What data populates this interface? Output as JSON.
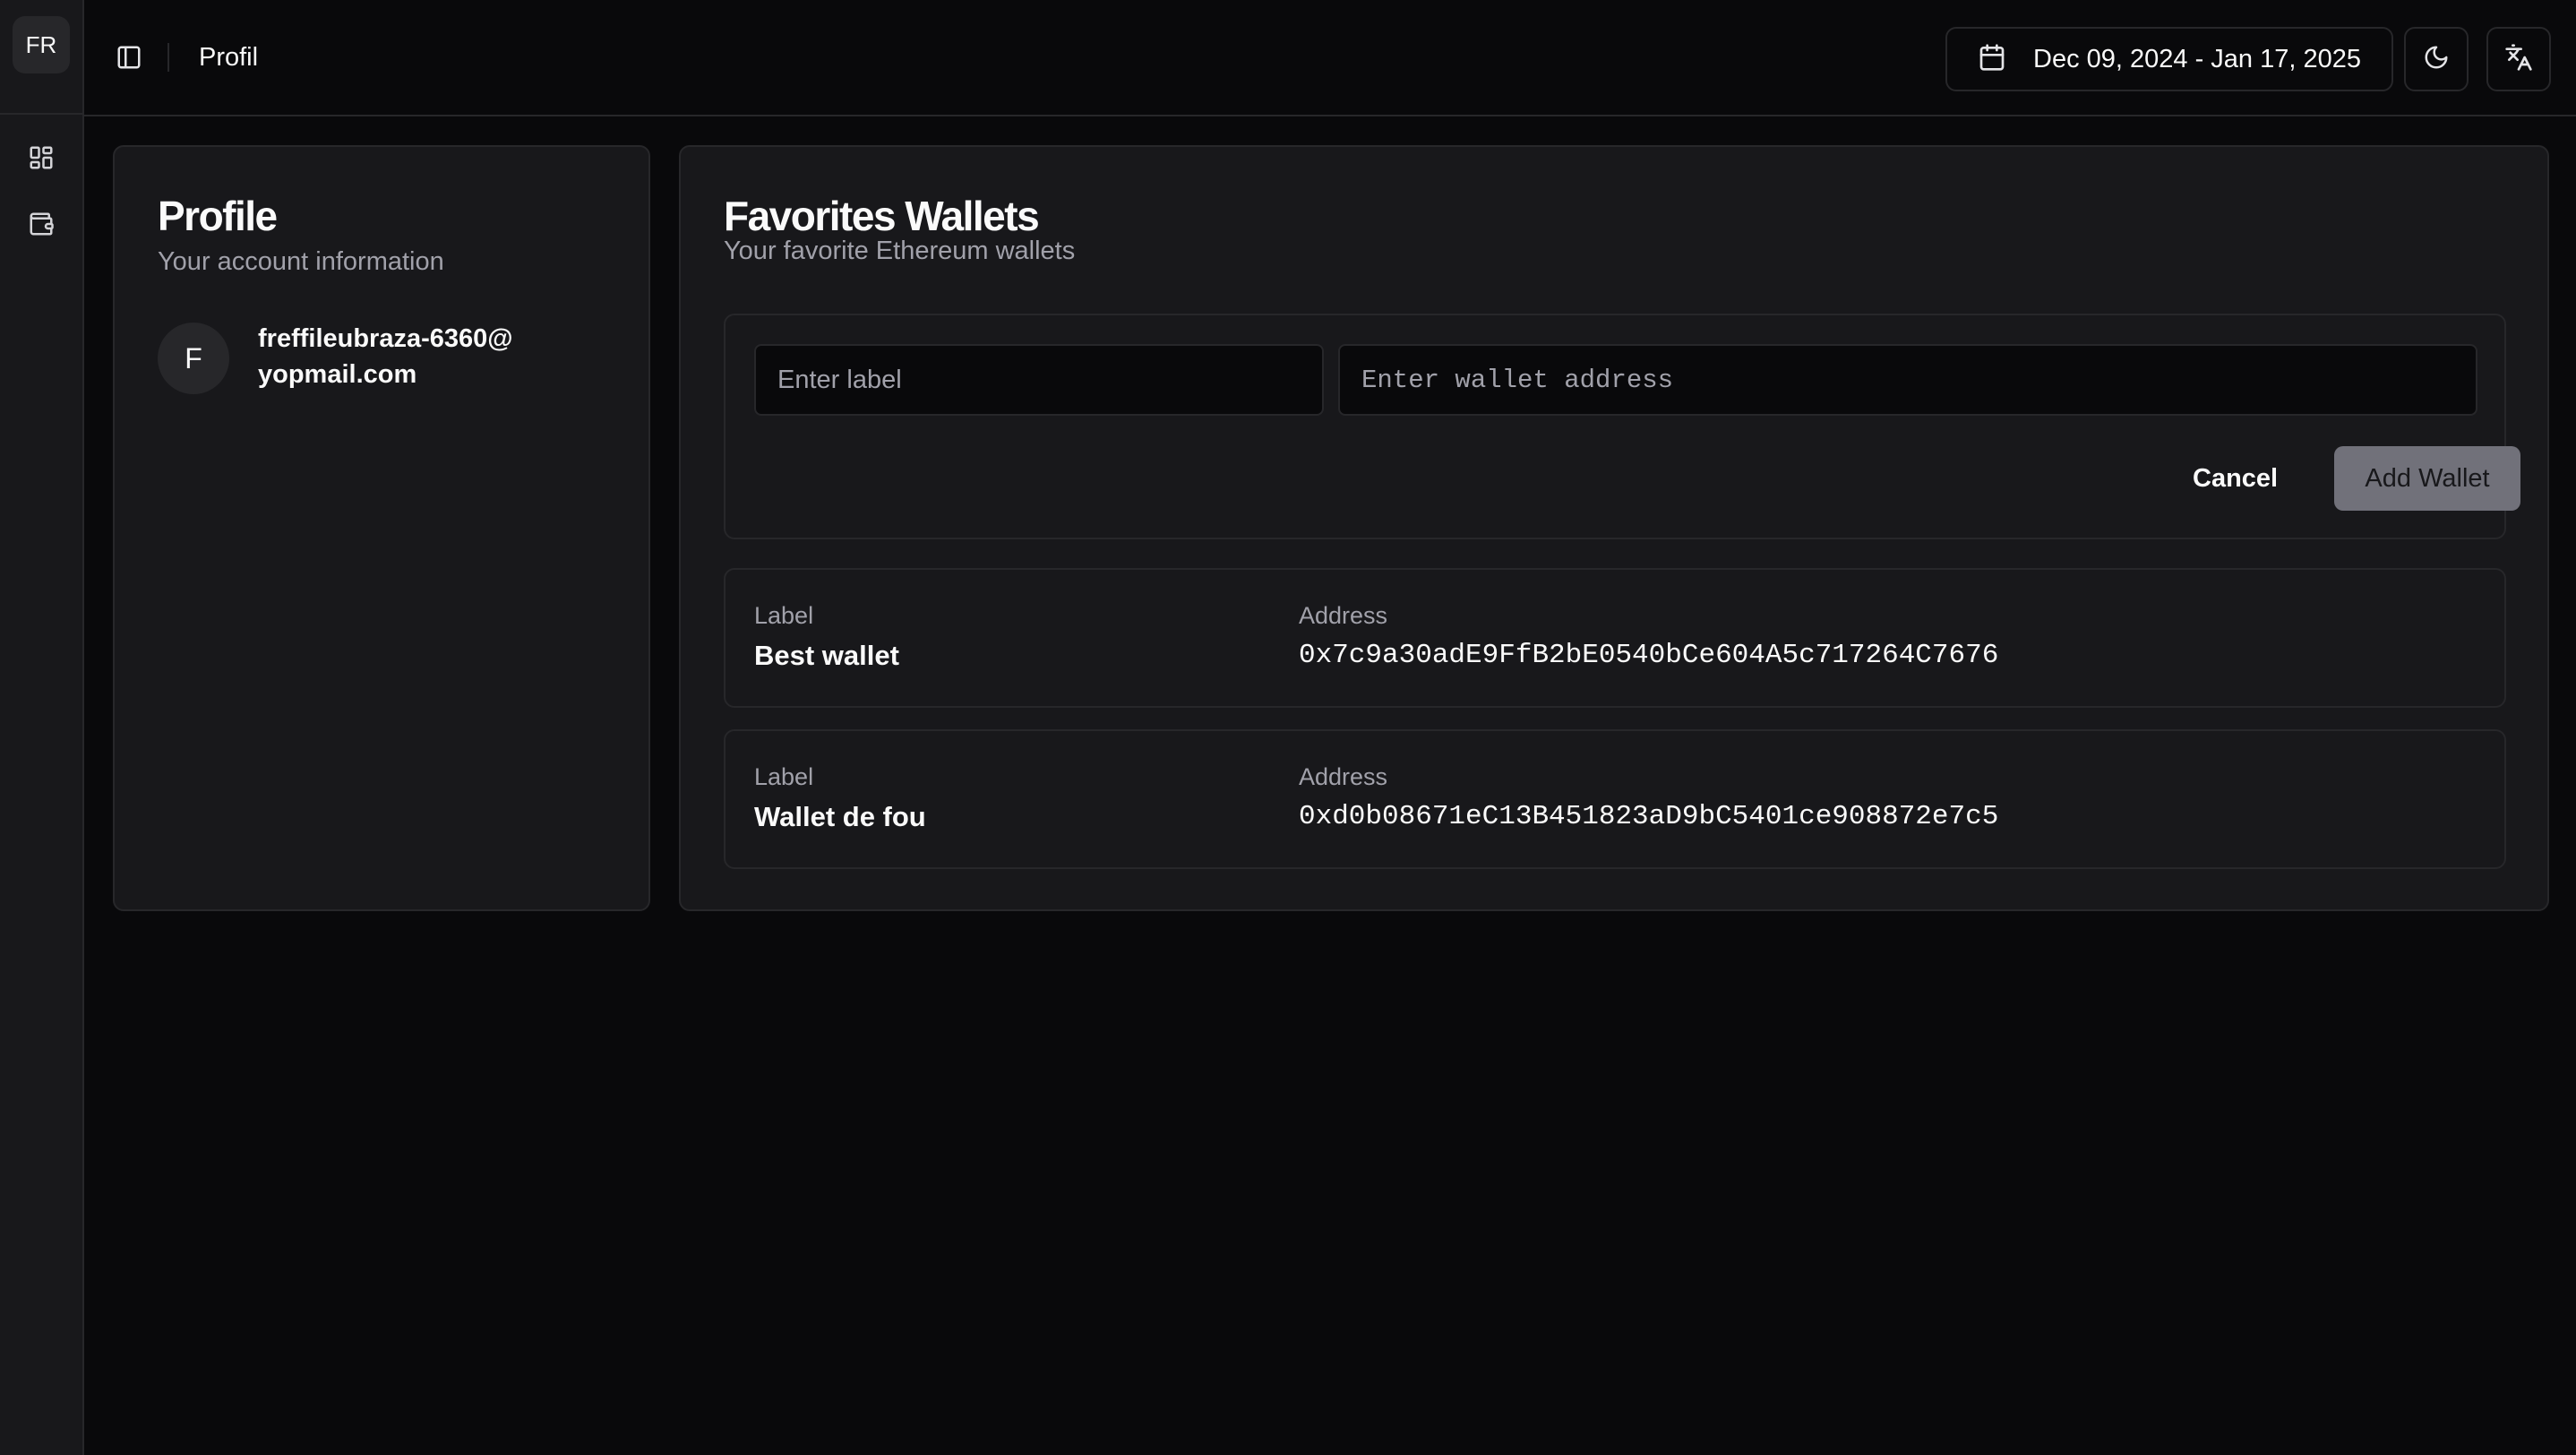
{
  "sidebar": {
    "avatar_initials": "FR",
    "items": [
      {
        "icon": "dashboard-icon"
      },
      {
        "icon": "wallet-icon"
      }
    ]
  },
  "header": {
    "title": "Profil",
    "date_range": "Dec 09, 2024 - Jan 17, 2025",
    "icons": [
      "sidebar-toggle-icon",
      "calendar-icon",
      "moon-icon",
      "translate-icon"
    ]
  },
  "profile": {
    "title": "Profile",
    "subtitle": "Your account information",
    "avatar_initial": "F",
    "email": "freffileubraza-6360@yopmail.com"
  },
  "wallets": {
    "title": "Favorites Wallets",
    "subtitle": "Your favorite Ethereum wallets",
    "form": {
      "label_placeholder": "Enter label",
      "label_value": "",
      "address_placeholder": "Enter wallet address",
      "address_value": "",
      "cancel_label": "Cancel",
      "add_label": "Add Wallet"
    },
    "list": [
      {
        "label_key": "Label",
        "label": "Best wallet",
        "address_key": "Address",
        "address": "0x7c9a30adE9FfB2bE0540bCe604A5c717264C7676"
      },
      {
        "label_key": "Label",
        "label": "Wallet de fou",
        "address_key": "Address",
        "address": "0xd0b08671eC13B451823aD9bC5401ce908872e7c5"
      }
    ]
  },
  "colors": {
    "background": "#09090b",
    "card": "#18181b",
    "border": "#27272a",
    "muted_text": "#a1a1aa",
    "button_disabled": "#71717a"
  }
}
